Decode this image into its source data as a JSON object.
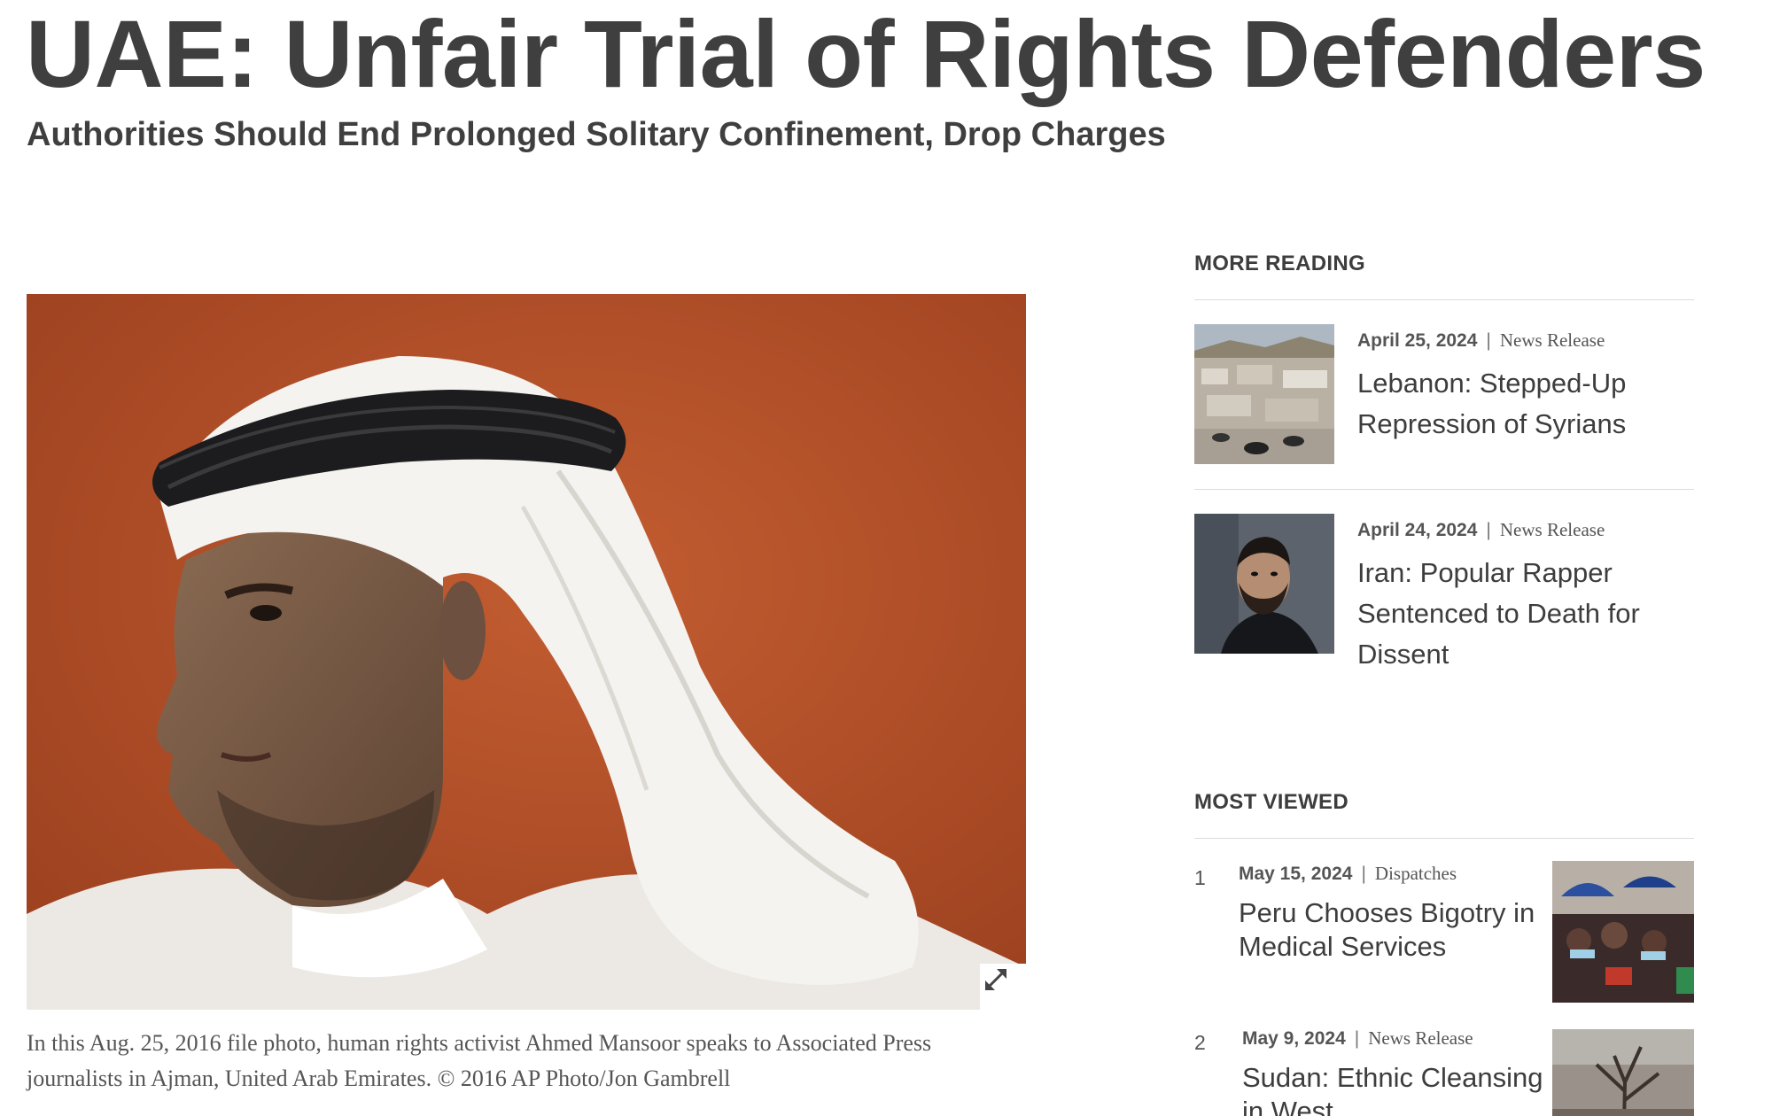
{
  "article": {
    "title": "UAE: Unfair Trial of Rights Defenders",
    "subtitle": "Authorities Should End Prolonged Solitary Confinement, Drop Charges",
    "caption": "In this Aug. 25, 2016 file photo, human rights activist Ahmed Mansoor speaks to Associated Press journalists in Ajman, United Arab Emirates. © 2016 AP Photo/Jon Gambrell"
  },
  "more_reading": {
    "heading": "MORE READING",
    "items": [
      {
        "date": "April 25, 2024",
        "type": "News Release",
        "title": "Lebanon: Stepped-Up Repression of Syrians"
      },
      {
        "date": "April 24, 2024",
        "type": "News Release",
        "title": "Iran: Popular Rapper Sentenced to Death for Dissent"
      }
    ]
  },
  "most_viewed": {
    "heading": "MOST VIEWED",
    "items": [
      {
        "rank": "1",
        "date": "May 15, 2024",
        "type": "Dispatches",
        "title": "Peru Chooses Bigotry in Medical Services"
      },
      {
        "rank": "2",
        "date": "May 9, 2024",
        "type": "News Release",
        "title": "Sudan: Ethnic Cleansing in West"
      }
    ]
  },
  "separator": "|",
  "icons": {
    "expand": "expand-icon"
  }
}
